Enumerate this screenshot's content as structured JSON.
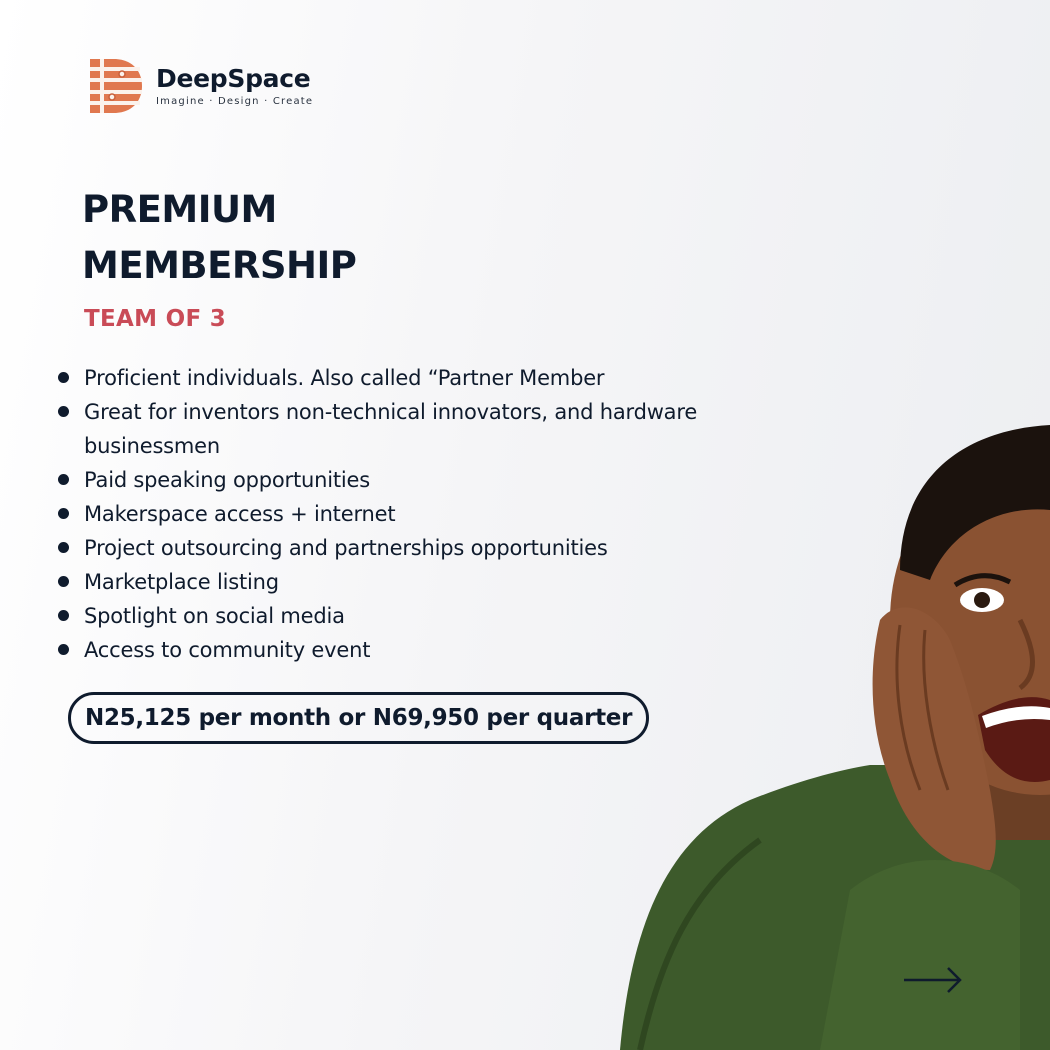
{
  "brand": {
    "name": "DeepSpace",
    "tagline": "Imagine · Design · Create",
    "accent_color": "#e0784f"
  },
  "title": {
    "line1": "PREMIUM",
    "line2": "MEMBERSHIP"
  },
  "subtitle": "TEAM OF 3",
  "features": [
    "Proficient individuals. Also called “Partner Member",
    "Great for inventors non-technical innovators, and hardware businessmen",
    "Paid speaking opportunities",
    "Makerspace access + internet",
    "Project outsourcing and partnerships opportunities",
    "Marketplace listing",
    "Spotlight on social media",
    "Access to community event"
  ],
  "price": "N25,125 per month or N69,950 per quarter",
  "colors": {
    "text_dark": "#0f1b2d",
    "subtitle_red": "#c94b57",
    "sweater_green": "#3d5a2b"
  },
  "icons": {
    "logo": "striped-d-logo-icon",
    "next": "right-arrow-icon"
  }
}
